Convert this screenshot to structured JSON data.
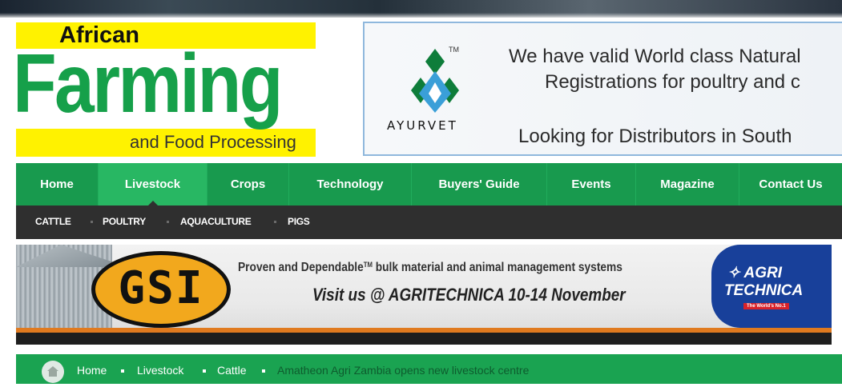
{
  "header": {
    "logo": {
      "line1": "African",
      "line2": "Farming",
      "line3": "and Food Processing",
      "colors": {
        "yellow": "#fff200",
        "green": "#16a04a"
      }
    }
  },
  "ads": {
    "ayurvet": {
      "brand": "AYURVET",
      "trademark": "TM",
      "line1": "We have valid World class Natural",
      "line2": "Registrations for poultry and c",
      "line3": "Looking for Distributors in South"
    },
    "gsi": {
      "logo": "GSI",
      "tagline_pre": "Proven and Dependable",
      "tagline_tm": "TM",
      "tagline_post": " bulk material and animal management systems",
      "visit": "Visit us @ AGRITECHNICA 10-14 November",
      "agri_line1": "AGRI",
      "agri_line2": "TECHNICA",
      "agri_badge": "The World's No.1"
    }
  },
  "nav": {
    "items": [
      "Home",
      "Livestock",
      "Crops",
      "Technology",
      "Buyers' Guide",
      "Events",
      "Magazine",
      "Contact Us"
    ],
    "active": "Livestock",
    "colors": {
      "bg": "#189a4e",
      "active": "#28b763"
    }
  },
  "subnav": {
    "items": [
      "CATTLE",
      "POULTRY",
      "AQUACULTURE",
      "PIGS"
    ]
  },
  "breadcrumb": {
    "items": [
      "Home",
      "Livestock",
      "Cattle"
    ],
    "current": "Amatheon Agri Zambia opens new livestock centre"
  }
}
